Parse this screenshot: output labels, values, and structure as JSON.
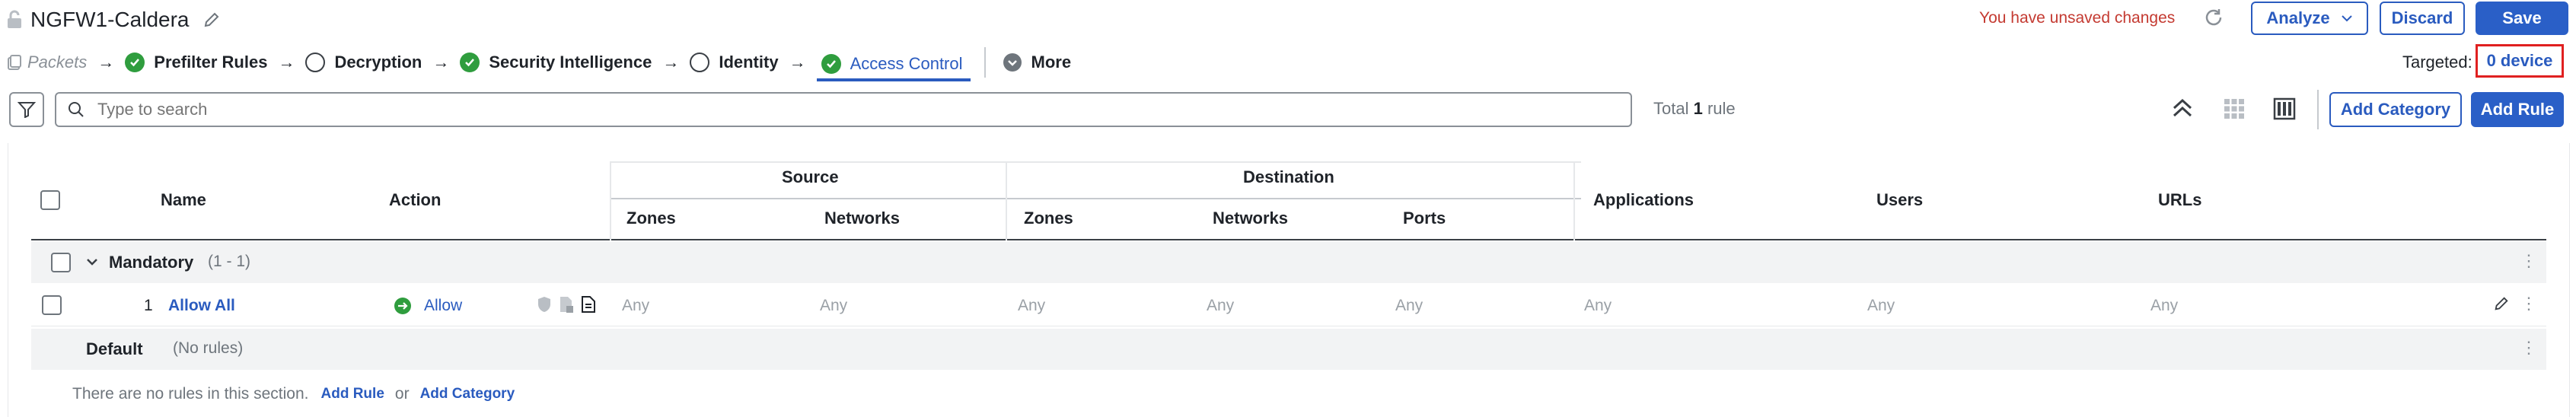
{
  "header": {
    "title": "NGFW1-Caldera",
    "unsaved": "You have unsaved changes",
    "analyze_label": "Analyze",
    "discard_label": "Discard",
    "save_label": "Save",
    "targeted_label": "Targeted:",
    "targeted_value": "0 device"
  },
  "breadcrumb": {
    "packets": "Packets",
    "items": [
      {
        "label": "Prefilter Rules",
        "status": "done"
      },
      {
        "label": "Decryption",
        "status": "empty"
      },
      {
        "label": "Security Intelligence",
        "status": "done"
      },
      {
        "label": "Identity",
        "status": "empty"
      },
      {
        "label": "Access Control",
        "status": "active"
      }
    ],
    "more_label": "More"
  },
  "toolbar": {
    "search_placeholder": "Type to search",
    "total_prefix": "Total",
    "total_count": "1",
    "total_suffix": "rule",
    "add_category_label": "Add Category",
    "add_rule_label": "Add Rule"
  },
  "table": {
    "headers": {
      "name": "Name",
      "action": "Action",
      "source": "Source",
      "destination": "Destination",
      "zones": "Zones",
      "networks": "Networks",
      "ports": "Ports",
      "applications": "Applications",
      "users": "Users",
      "urls": "URLs"
    },
    "mandatory": {
      "label": "Mandatory",
      "range": "(1 - 1)"
    },
    "rule": {
      "number": "1",
      "name": "Allow All",
      "action": "Allow",
      "any": "Any"
    },
    "default": {
      "label": "Default",
      "note": "(No rules)"
    },
    "empty_section": {
      "text": "There are no rules in this section.",
      "add_rule": "Add Rule",
      "or": "or",
      "add_category": "Add Category"
    }
  },
  "colors": {
    "accent": "#2a5bbf",
    "success": "#2f9d3e",
    "error": "#c43a31"
  }
}
